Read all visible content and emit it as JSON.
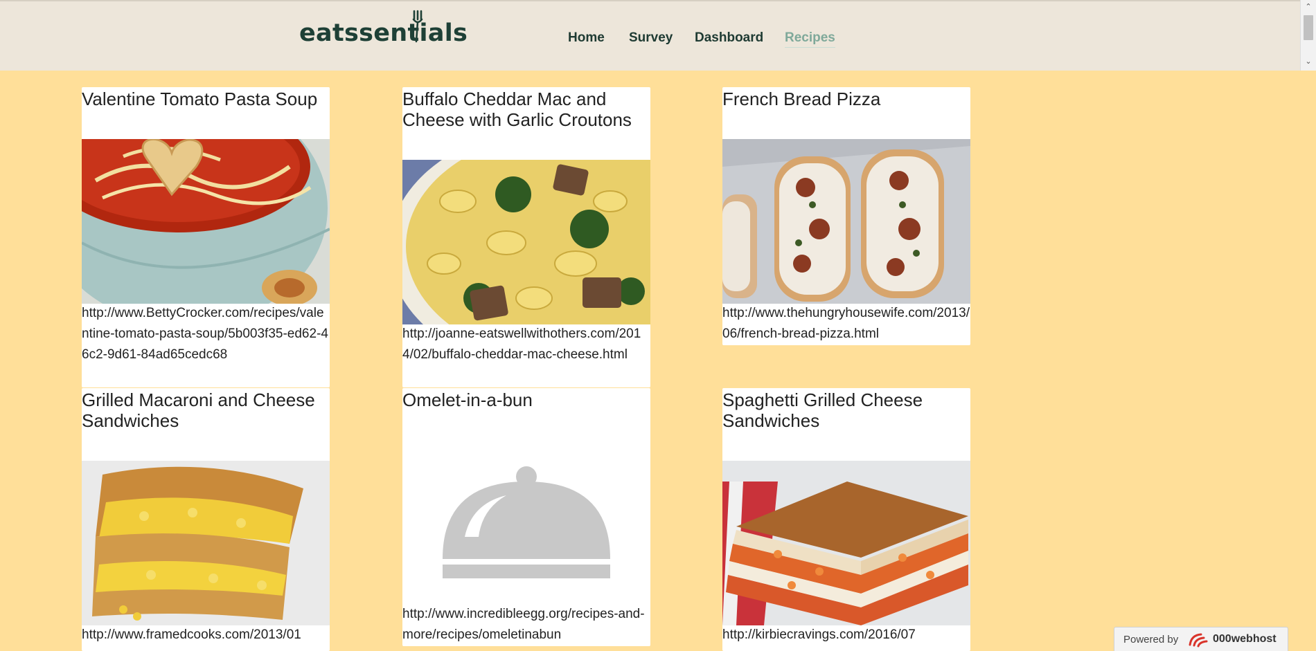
{
  "header": {
    "logo_text": "eatssentials",
    "nav": [
      {
        "label": "Home",
        "active": false
      },
      {
        "label": "Survey",
        "active": false
      },
      {
        "label": "Dashboard",
        "active": false
      },
      {
        "label": "Recipes",
        "active": true
      }
    ]
  },
  "recipes": [
    {
      "title": "Valentine Tomato Pasta Soup",
      "url": "http://www.BettyCrocker.com/recipes/valentine-tomato-pasta-soup/5b003f35-ed62-46c2-9d61-84ad65cedc68",
      "image": "tomato-pasta-soup-photo"
    },
    {
      "title": "Buffalo Cheddar Mac and Cheese with Garlic Croutons",
      "url": "http://joanne-eatswellwithothers.com/2014/02/buffalo-cheddar-mac-cheese.html",
      "image": "mac-and-cheese-broccoli-photo"
    },
    {
      "title": "French Bread Pizza",
      "url": "http://www.thehungryhousewife.com/2013/06/french-bread-pizza.html",
      "image": "french-bread-pizza-photo"
    },
    {
      "title": "Grilled Macaroni and Cheese Sandwiches",
      "url": "http://www.framedcooks.com/2013/01",
      "image": "grilled-mac-cheese-sandwich-photo"
    },
    {
      "title": "Omelet-in-a-bun",
      "url": "http://www.incredibleegg.org/recipes-and-more/recipes/omeletinabun",
      "image": "placeholder-cloche-icon"
    },
    {
      "title": "Spaghetti Grilled Cheese Sandwiches",
      "url": "http://kirbiecravings.com/2016/07",
      "image": "spaghetti-grilled-cheese-photo"
    }
  ],
  "footer_badge": {
    "label": "Powered by",
    "brand": "000webhost"
  },
  "colors": {
    "page_background": "#ffdf99",
    "navbar_background": "#ede6da",
    "nav_text": "#1e3a32",
    "nav_active": "#7fa99a",
    "card_background": "#ffffff"
  }
}
